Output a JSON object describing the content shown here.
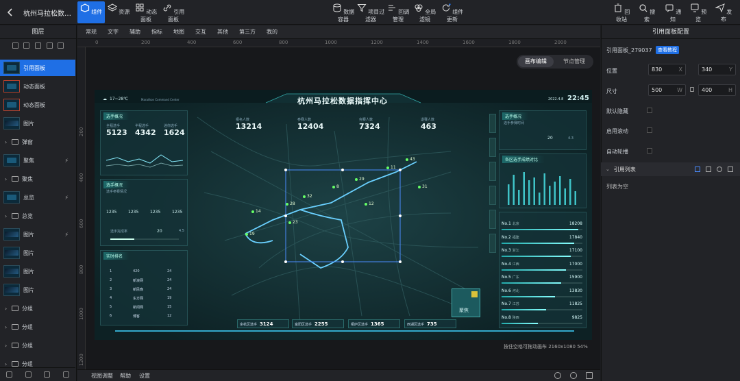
{
  "app": {
    "title": "杭州马拉松数据..."
  },
  "toolbar_left": [
    {
      "label": "组件",
      "icon": "hexagon-icon",
      "active": true
    },
    {
      "label": "资源",
      "icon": "layers-icon",
      "active": false
    },
    {
      "label": "动态面板",
      "icon": "grid-icon",
      "active": false
    },
    {
      "label": "引用面板",
      "icon": "link-icon",
      "active": false
    }
  ],
  "toolbar_center": [
    {
      "label": "数据容器",
      "icon": "database-icon"
    },
    {
      "label": "项目过滤器",
      "icon": "filter-icon"
    },
    {
      "label": "回调管理",
      "icon": "callback-icon"
    },
    {
      "label": "全局滤镜",
      "icon": "sliders-icon"
    },
    {
      "label": "组件更新",
      "icon": "refresh-icon"
    }
  ],
  "toolbar_right": [
    {
      "label": "回收站",
      "icon": "trash-icon"
    },
    {
      "label": "搜索",
      "icon": "search-icon"
    },
    {
      "label": "通知",
      "icon": "bell-icon"
    },
    {
      "label": "预览",
      "icon": "monitor-icon"
    },
    {
      "label": "发布",
      "icon": "send-icon"
    }
  ],
  "left_panel": {
    "title": "图层",
    "layers": [
      {
        "type": "item",
        "label": "引用面板",
        "thumb": "panel",
        "selected": true
      },
      {
        "type": "item",
        "label": "动态面板",
        "thumb": "red"
      },
      {
        "type": "item",
        "label": "动态面板",
        "thumb": "red"
      },
      {
        "type": "item",
        "label": "图片",
        "thumb": "img"
      },
      {
        "type": "folder",
        "label": "弹窗"
      },
      {
        "type": "item",
        "label": "聚焦",
        "thumb": "panel",
        "link": true
      },
      {
        "type": "folder",
        "label": "聚焦"
      },
      {
        "type": "item",
        "label": "总览",
        "thumb": "panel",
        "link": true
      },
      {
        "type": "folder",
        "label": "总览"
      },
      {
        "type": "item",
        "label": "图片",
        "thumb": "img",
        "link": true
      },
      {
        "type": "item",
        "label": "图片",
        "thumb": "img"
      },
      {
        "type": "item",
        "label": "图片",
        "thumb": "img"
      },
      {
        "type": "item",
        "label": "图片",
        "thumb": "img"
      },
      {
        "type": "folder",
        "label": "分组"
      },
      {
        "type": "folder",
        "label": "分组"
      },
      {
        "type": "folder",
        "label": "分组"
      },
      {
        "type": "folder",
        "label": "分组"
      }
    ]
  },
  "categories": [
    "常规",
    "文字",
    "辅助",
    "指标",
    "地图",
    "交互",
    "其他",
    "第三方",
    "我的"
  ],
  "ruler_h": [
    "0",
    "200",
    "400",
    "600",
    "800",
    "1000",
    "1200",
    "1400",
    "1600",
    "1800",
    "2000"
  ],
  "ruler_v": [
    "200",
    "400",
    "600",
    "800",
    "1000",
    "1200"
  ],
  "canvas_modes": [
    {
      "label": "画布编辑",
      "active": true
    },
    {
      "label": "节点管理",
      "active": false
    }
  ],
  "canvas_hint": "按住空格可拖动画布  2160x1080 54%",
  "bottom_bar": [
    "视图调整",
    "帮助",
    "设置"
  ],
  "right_panel": {
    "title": "引用面板配置",
    "name": "引用面板_279037",
    "doc_link": "查看教程",
    "position": {
      "label": "位置",
      "x": "830",
      "x_unit": "X",
      "y": "340",
      "y_unit": "Y"
    },
    "size": {
      "label": "尺寸",
      "w": "500",
      "w_unit": "W",
      "h": "400",
      "h_unit": "H"
    },
    "toggles": [
      "默认隐藏",
      "启用滚动",
      "自动轮播"
    ],
    "list_title": "引用列表",
    "list_empty": "列表为空"
  },
  "dashboard": {
    "title": "杭州马拉松数据指挥中心",
    "weather": "17~28℃",
    "subtitle": "Marathon Command Center",
    "date": "2022.4.8",
    "time": "22:45",
    "top_stats": [
      {
        "label": "报名人数",
        "value": "13214"
      },
      {
        "label": "参赛人数",
        "value": "12404"
      },
      {
        "label": "完赛人数",
        "value": "7324"
      },
      {
        "label": "退赛人数",
        "value": "463"
      }
    ],
    "left_top": {
      "title": "选手概况",
      "stats": [
        {
          "label": "全程选手",
          "value": "5123"
        },
        {
          "label": "半程选手",
          "value": "4342"
        },
        {
          "label": "迷你选手",
          "value": "1624"
        }
      ]
    },
    "left_mid": {
      "title": "选手概况",
      "sub": "选手参赛情况",
      "values": [
        "1235",
        "1235",
        "1235",
        "1235"
      ],
      "progress_label": "选手完成率",
      "progress_value": "20",
      "progress_unit": "4.5"
    },
    "left_table": {
      "title": "实时排名",
      "rows": [
        [
          "1",
          "420",
          "24"
        ],
        [
          "2",
          "新浪网",
          "24"
        ],
        [
          "3",
          "新民晚",
          "24"
        ],
        [
          "4",
          "东方网",
          "19"
        ],
        [
          "5",
          "新闻网",
          "15"
        ],
        [
          "6",
          "博客",
          "12"
        ]
      ]
    },
    "right_top": {
      "title": "选手概况",
      "sub": "选手参赛时间",
      "value": "20",
      "range": "4.3"
    },
    "right_mid": {
      "title": "各区选手成绩对比"
    },
    "ranks": [
      {
        "rank": "No.1",
        "city": "北京",
        "value": "18208",
        "pct": 0.95
      },
      {
        "rank": "No.2",
        "city": "福建",
        "value": "17840",
        "pct": 0.9
      },
      {
        "rank": "No.3",
        "city": "浙江",
        "value": "17100",
        "pct": 0.86
      },
      {
        "rank": "No.4",
        "city": "江西",
        "value": "17000",
        "pct": 0.8
      },
      {
        "rank": "No.5",
        "city": "广东",
        "value": "15900",
        "pct": 0.74
      },
      {
        "rank": "No.6",
        "city": "河北",
        "value": "13830",
        "pct": 0.66
      },
      {
        "rank": "No.7",
        "city": "江苏",
        "value": "11825",
        "pct": 0.55
      },
      {
        "rank": "No.8",
        "city": "陕西",
        "value": "9825",
        "pct": 0.45
      }
    ],
    "pins": [
      "11",
      "43",
      "29",
      "8",
      "32",
      "31",
      "28",
      "12",
      "14",
      "23",
      "19"
    ],
    "bottom_stats": [
      {
        "label": "余杭区选手",
        "value": "3124"
      },
      {
        "label": "富阳区选手",
        "value": "2255"
      },
      {
        "label": "桐庐区选手",
        "value": "1365"
      },
      {
        "label": "西湖区选手",
        "value": "735"
      }
    ],
    "focus_label": "聚焦"
  }
}
